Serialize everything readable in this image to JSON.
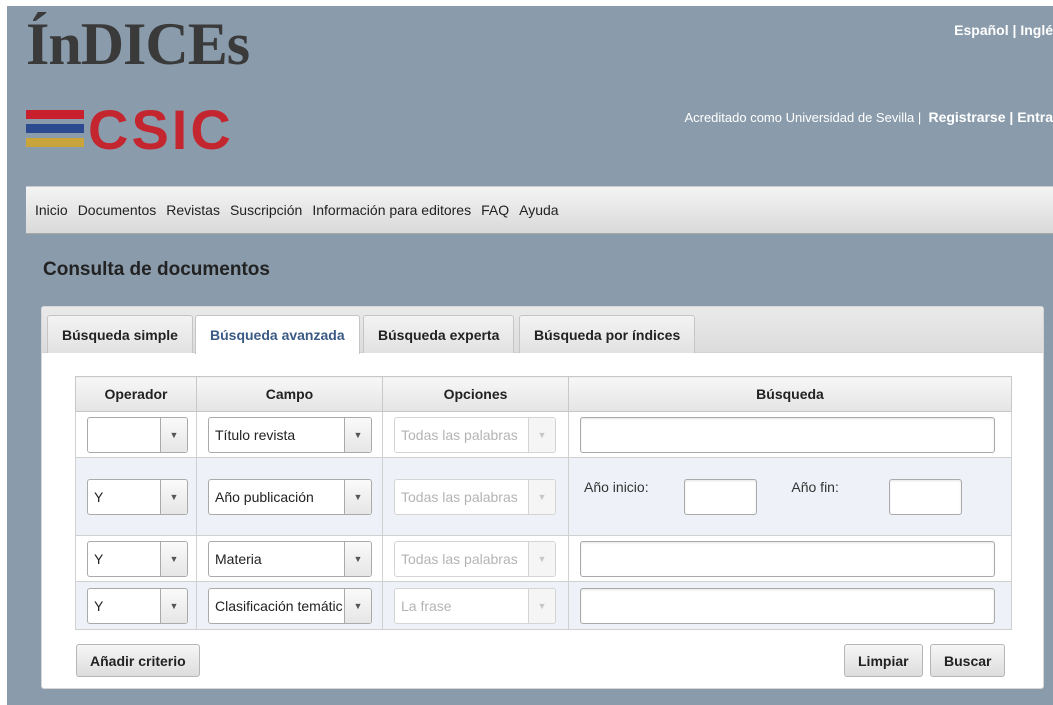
{
  "logo": {
    "indices_text": "ÍnDICEs",
    "csic_text": "CSIC",
    "bar_colors": [
      "#c8202c",
      "#2c4a8f",
      "#c9a43a"
    ]
  },
  "header": {
    "lang_es": "Español",
    "lang_sep": " | ",
    "lang_en": "Inglé",
    "accredited": "Acreditado como Universidad de Sevilla |",
    "register": "Registrarse",
    "user_sep": " | ",
    "login": "Entra"
  },
  "nav": {
    "items": [
      "Inicio",
      "Documentos",
      "Revistas",
      "Suscripción",
      "Información para editores",
      "FAQ",
      "Ayuda"
    ]
  },
  "page": {
    "title": "Consulta de documentos"
  },
  "tabs": [
    {
      "label": "Búsqueda simple",
      "active": false
    },
    {
      "label": "Búsqueda avanzada",
      "active": true
    },
    {
      "label": "Búsqueda experta",
      "active": false
    },
    {
      "label": "Búsqueda por índices",
      "active": false
    }
  ],
  "table": {
    "headers": [
      "Operador",
      "Campo",
      "Opciones",
      "Búsqueda"
    ],
    "rows": [
      {
        "operador": "",
        "campo": "Título revista",
        "opciones": "Todas las palabras"
      },
      {
        "operador": "Y",
        "campo": "Año publicación",
        "opciones": "Todas las palabras",
        "year_start_label": "Año inicio:",
        "year_end_label": "Año fin:"
      },
      {
        "operador": "Y",
        "campo": "Materia",
        "opciones": "Todas las palabras"
      },
      {
        "operador": "Y",
        "campo": "Clasificación temática",
        "opciones": "La frase"
      }
    ]
  },
  "buttons": {
    "add": "Añadir criterio",
    "clear": "Limpiar",
    "search": "Buscar"
  }
}
